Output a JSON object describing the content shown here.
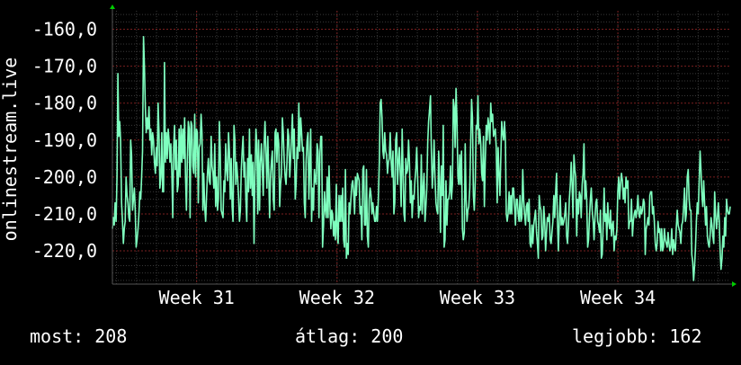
{
  "colors": {
    "background": "#000000",
    "plot_background": "#000000",
    "grid_major": "#7a1f1f",
    "grid_minor": "#3a3a3a",
    "line": "#7fffbf",
    "text": "#ffffff",
    "axis_arrow": "#00cc00"
  },
  "chart_data": {
    "type": "line",
    "ylabel": "onlinestream.live",
    "xlabel": "",
    "title": "",
    "ylim": [
      -229,
      -155
    ],
    "xlim": [
      30.4,
      34.8
    ],
    "y_ticks": [
      -160,
      -170,
      -180,
      -190,
      -200,
      -210,
      -220
    ],
    "y_tick_labels": [
      "-160,0",
      "-170,0",
      "-180,0",
      "-190,0",
      "-200,0",
      "-210,0",
      "-220,0"
    ],
    "x_ticks": [
      31,
      32,
      33,
      34
    ],
    "x_tick_labels": [
      "Week 31",
      "Week 32",
      "Week 33",
      "Week 34"
    ],
    "grid": true,
    "series": [
      {
        "x_start": 30.4,
        "x_end": 34.8,
        "values": [
          -214,
          -211,
          -213,
          -207,
          -212,
          -200,
          -172,
          -189,
          -185,
          -190,
          -207,
          -212,
          -218,
          -214,
          -212,
          -200,
          -205,
          -207,
          -211,
          -212,
          -190,
          -194,
          -209,
          -206,
          -203,
          -209,
          -219,
          -217,
          -214,
          -210,
          -204,
          -206,
          -200,
          -193,
          -162,
          -170,
          -181,
          -188,
          -184,
          -187,
          -181,
          -190,
          -187,
          -194,
          -188,
          -190,
          -196,
          -199,
          -192,
          -197,
          -180,
          -188,
          -203,
          -200,
          -188,
          -204,
          -204,
          -169,
          -196,
          -188,
          -195,
          -187,
          -190,
          -196,
          -191,
          -199,
          -211,
          -192,
          -186,
          -198,
          -190,
          -204,
          -202,
          -187,
          -200,
          -186,
          -196,
          -187,
          -195,
          -184,
          -200,
          -209,
          -196,
          -185,
          -187,
          -211,
          -185,
          -186,
          -197,
          -199,
          -183,
          -200,
          -187,
          -188,
          -207,
          -192,
          -191,
          -183,
          -188,
          -209,
          -199,
          -208,
          -212,
          -205,
          -199,
          -195,
          -201,
          -202,
          -189,
          -197,
          -199,
          -203,
          -191,
          -208,
          -200,
          -209,
          -206,
          -185,
          -193,
          -209,
          -210,
          -211,
          -201,
          -204,
          -191,
          -198,
          -201,
          -188,
          -193,
          -206,
          -195,
          -208,
          -212,
          -186,
          -190,
          -202,
          -196,
          -200,
          -205,
          -212,
          -209,
          -198,
          -193,
          -189,
          -200,
          -196,
          -206,
          -212,
          -195,
          -204,
          -187,
          -203,
          -194,
          -205,
          -196,
          -218,
          -200,
          -187,
          -191,
          -210,
          -190,
          -209,
          -196,
          -191,
          -198,
          -205,
          -191,
          -185,
          -193,
          -203,
          -189,
          -199,
          -211,
          -200,
          -196,
          -193,
          -206,
          -209,
          -188,
          -187,
          -196,
          -188,
          -191,
          -208,
          -202,
          -199,
          -184,
          -188,
          -196,
          -200,
          -202,
          -196,
          -187,
          -189,
          -200,
          -195,
          -189,
          -183,
          -195,
          -187,
          -206,
          -202,
          -192,
          -195,
          -180,
          -193,
          -184,
          -188,
          -193,
          -192,
          -207,
          -211,
          -196,
          -190,
          -188,
          -206,
          -197,
          -187,
          -212,
          -203,
          -209,
          -198,
          -201,
          -202,
          -191,
          -193,
          -211,
          -194,
          -189,
          -189,
          -219,
          -213,
          -204,
          -209,
          -211,
          -200,
          -211,
          -197,
          -208,
          -214,
          -209,
          -210,
          -216,
          -212,
          -217,
          -202,
          -215,
          -218,
          -205,
          -212,
          -205,
          -212,
          -203,
          -217,
          -219,
          -198,
          -222,
          -218,
          -221,
          -207,
          -210,
          -206,
          -202,
          -201,
          -204,
          -210,
          -200,
          -205,
          -199,
          -200,
          -201,
          -210,
          -208,
          -217,
          -198,
          -197,
          -213,
          -213,
          -198,
          -216,
          -219,
          -206,
          -203,
          -205,
          -210,
          -207,
          -210,
          -212,
          -212,
          -208,
          -212,
          -206,
          -196,
          -180,
          -179,
          -184,
          -193,
          -195,
          -188,
          -193,
          -194,
          -199,
          -196,
          -195,
          -188,
          -196,
          -200,
          -193,
          -210,
          -207,
          -190,
          -188,
          -202,
          -196,
          -192,
          -199,
          -208,
          -187,
          -198,
          -210,
          -212,
          -195,
          -199,
          -198,
          -190,
          -196,
          -207,
          -201,
          -211,
          -205,
          -206,
          -201,
          -198,
          -192,
          -200,
          -211,
          -208,
          -209,
          -194,
          -210,
          -203,
          -199,
          -212,
          -208,
          -203,
          -191,
          -185,
          -182,
          -178,
          -193,
          -203,
          -198,
          -190,
          -200,
          -207,
          -209,
          -210,
          -193,
          -201,
          -215,
          -197,
          -205,
          -186,
          -219,
          -217,
          -201,
          -213,
          -206,
          -206,
          -204,
          -197,
          -206,
          -202,
          -179,
          -181,
          -192,
          -176,
          -184,
          -200,
          -202,
          -194,
          -202,
          -193,
          -214,
          -217,
          -215,
          -191,
          -206,
          -212,
          -209,
          -208,
          -203,
          -191,
          -179,
          -184,
          -205,
          -209,
          -201,
          -186,
          -187,
          -178,
          -191,
          -187,
          -191,
          -199,
          -201,
          -189,
          -208,
          -196,
          -186,
          -190,
          -184,
          -186,
          -191,
          -180,
          -185,
          -183,
          -189,
          -188,
          -187,
          -192,
          -207,
          -192,
          -199,
          -205,
          -195,
          -185,
          -188,
          -190,
          -185,
          -190,
          -210,
          -212,
          -210,
          -204,
          -210,
          -205,
          -210,
          -203,
          -203,
          -208,
          -213,
          -206,
          -206,
          -210,
          -212,
          -205,
          -212,
          -211,
          -198,
          -206,
          -210,
          -213,
          -208,
          -207,
          -212,
          -206,
          -218,
          -219,
          -213,
          -218,
          -213,
          -211,
          -209,
          -215,
          -218,
          -222,
          -205,
          -208,
          -209,
          -217,
          -216,
          -208,
          -212,
          -220,
          -215,
          -211,
          -212,
          -210,
          -217,
          -218,
          -215,
          -212,
          -205,
          -211,
          -204,
          -199,
          -212,
          -220,
          -211,
          -205,
          -213,
          -211,
          -213,
          -212,
          -210,
          -207,
          -216,
          -218,
          -213,
          -206,
          -202,
          -196,
          -202,
          -211,
          -194,
          -198,
          -200,
          -216,
          -206,
          -210,
          -204,
          -205,
          -211,
          -202,
          -199,
          -191,
          -206,
          -201,
          -206,
          -219,
          -217,
          -211,
          -206,
          -203,
          -209,
          -212,
          -217,
          -211,
          -207,
          -206,
          -212,
          -213,
          -215,
          -209,
          -222,
          -221,
          -213,
          -203,
          -212,
          -210,
          -217,
          -207,
          -212,
          -214,
          -209,
          -216,
          -213,
          -212,
          -220,
          -216,
          -217,
          -214,
          -204,
          -200,
          -206,
          -202,
          -199,
          -201,
          -206,
          -203,
          -207,
          -200,
          -203,
          -201,
          -214,
          -212,
          -212,
          -206,
          -216,
          -212,
          -210,
          -209,
          -211,
          -209,
          -205,
          -210,
          -211,
          -208,
          -210,
          -209,
          -206,
          -207,
          -221,
          -214,
          -213,
          -211,
          -213,
          -205,
          -204,
          -204,
          -210,
          -208,
          -212,
          -218,
          -220,
          -218,
          -212,
          -215,
          -214,
          -220,
          -214,
          -220,
          -219,
          -214,
          -217,
          -218,
          -219,
          -215,
          -218,
          -220,
          -219,
          -214,
          -221,
          -217,
          -219,
          -220,
          -214,
          -209,
          -213,
          -214,
          -215,
          -218,
          -213,
          -212,
          -208,
          -203,
          -212,
          -210,
          -200,
          -198,
          -206,
          -209,
          -209,
          -221,
          -223,
          -228,
          -224,
          -219,
          -212,
          -207,
          -210,
          -202,
          -193,
          -198,
          -205,
          -208,
          -201,
          -207,
          -213,
          -208,
          -216,
          -218,
          -219,
          -216,
          -211,
          -213,
          -216,
          -218,
          -204,
          -210,
          -214,
          -211,
          -207,
          -212,
          -220,
          -225,
          -222,
          -216,
          -219,
          -211,
          -216,
          -206,
          -209,
          -210,
          -210,
          -208
        ]
      }
    ]
  },
  "legend_stats": {
    "current": "most: 208",
    "average": "átlag: 200",
    "best": "legjobb: 162"
  }
}
